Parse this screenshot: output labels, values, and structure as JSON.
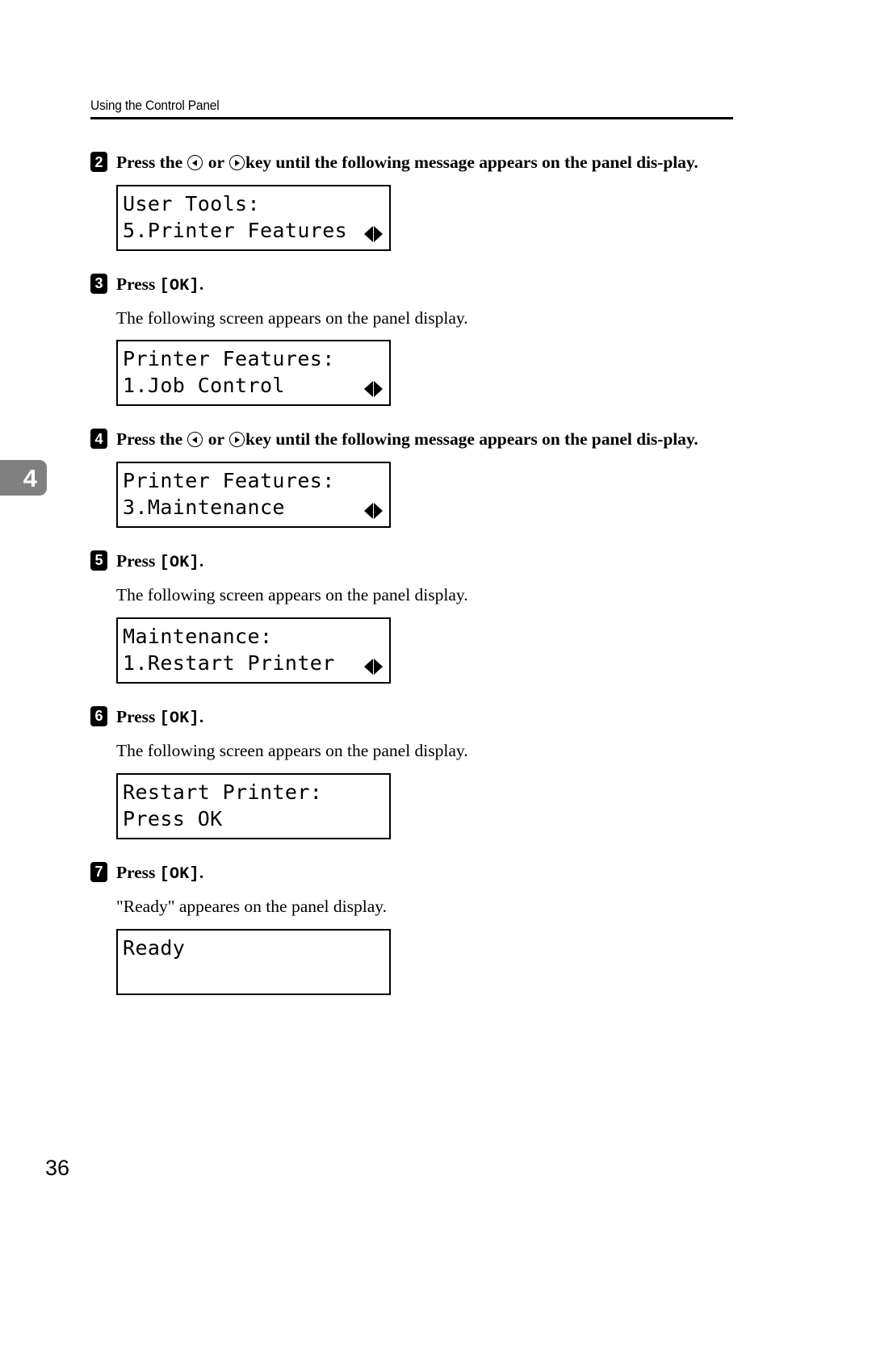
{
  "header": {
    "title": "Using the Control Panel"
  },
  "chapter_tab": {
    "number": "4"
  },
  "page_number": "36",
  "steps": [
    {
      "badge": "2",
      "head_before": "Press the ",
      "head_middle": " or ",
      "head_after": "key until the following message appears on the panel dis-play.",
      "icon_left": "arrow-left-key-icon",
      "icon_right": "arrow-right-key-icon",
      "note": "",
      "lcd": {
        "line1": "User Tools:",
        "line2": "5.Printer Features",
        "arrows": true
      }
    },
    {
      "badge": "3",
      "head_before": "Press ",
      "key": "[OK]",
      "head_after": ".",
      "note": "The following screen appears on the panel display.",
      "lcd": {
        "line1": "Printer Features:",
        "line2": "1.Job Control",
        "arrows": true
      }
    },
    {
      "badge": "4",
      "head_before": "Press the ",
      "head_middle": " or ",
      "head_after": "key until the following message appears on the panel dis-play.",
      "icon_left": "arrow-left-key-icon",
      "icon_right": "arrow-right-key-icon",
      "note": "",
      "lcd": {
        "line1": "Printer Features:",
        "line2": "3.Maintenance",
        "arrows": true
      }
    },
    {
      "badge": "5",
      "head_before": "Press ",
      "key": "[OK]",
      "head_after": ".",
      "note": "The following screen appears on the panel display.",
      "lcd": {
        "line1": "Maintenance:",
        "line2": "1.Restart Printer",
        "arrows": true
      }
    },
    {
      "badge": "6",
      "head_before": "Press ",
      "key": "[OK]",
      "head_after": ".",
      "note": "The following screen appears on the panel display.",
      "lcd": {
        "line1": "Restart Printer:",
        "line2": "Press OK",
        "arrows": false
      }
    },
    {
      "badge": "7",
      "head_before": "Press ",
      "key": "[OK]",
      "head_after": ".",
      "note": "\"Ready\" appeares on the panel display.",
      "lcd": {
        "line1": "Ready",
        "line2": "",
        "arrows": false
      }
    }
  ],
  "colors": {
    "ink": "#000000",
    "paper": "#ffffff",
    "chapter_tab": "#808080"
  }
}
